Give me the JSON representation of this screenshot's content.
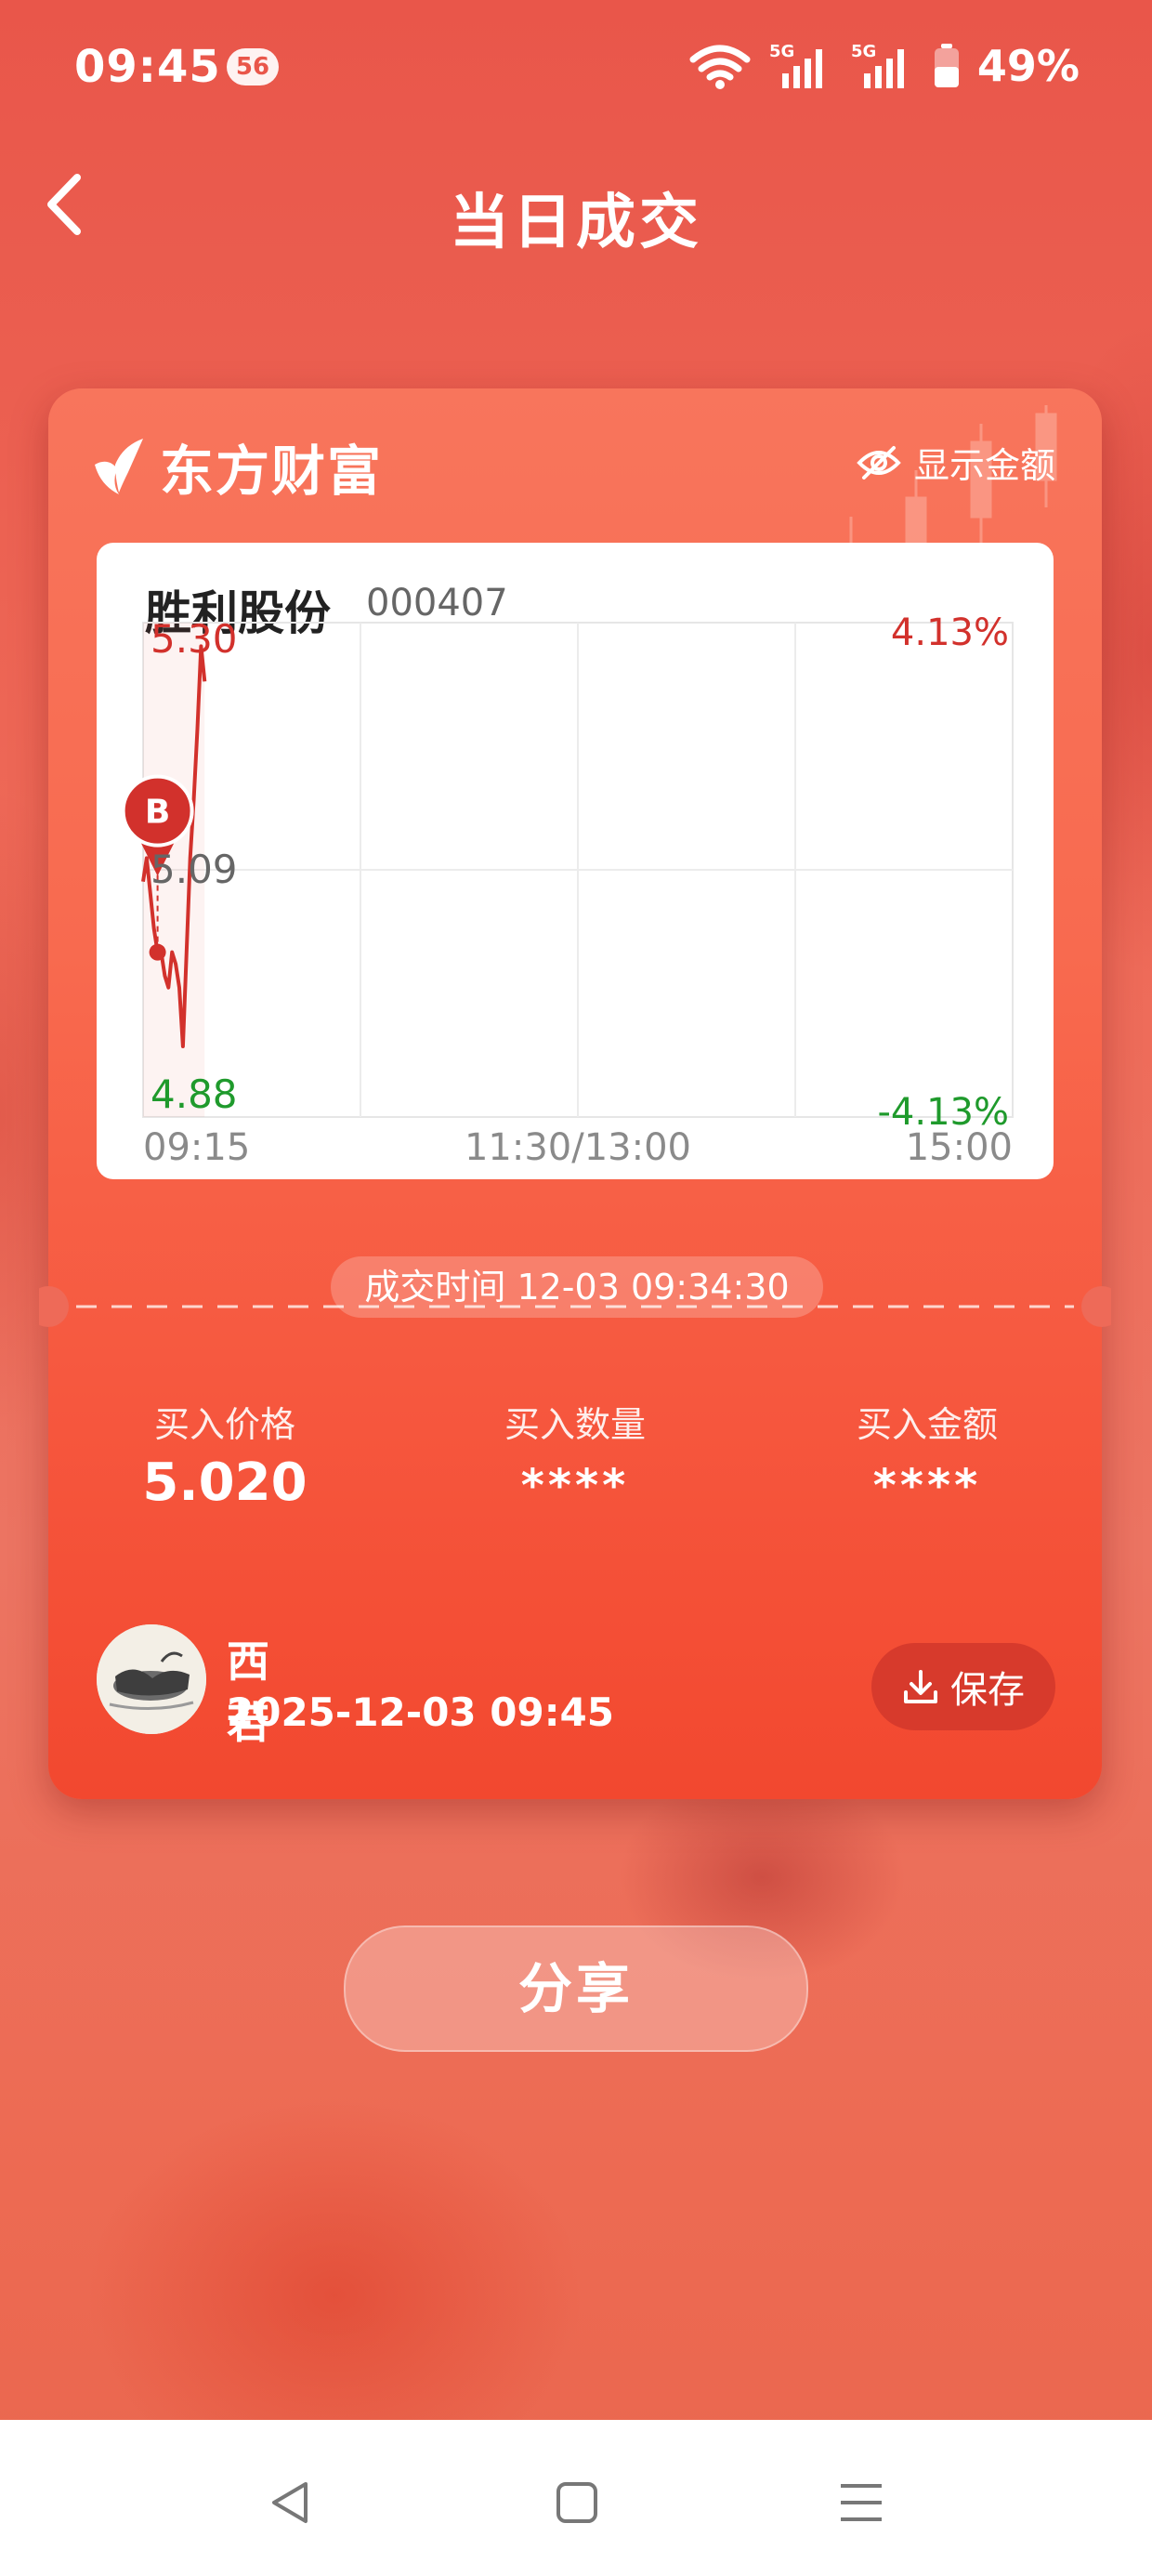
{
  "status_bar": {
    "time": "09:45",
    "badge": "56",
    "battery": "49%",
    "network_1": "5G",
    "network_2": "5G"
  },
  "nav": {
    "title": "当日成交",
    "back_icon": "chevron-left-icon"
  },
  "card": {
    "brand": "东方财富",
    "show_amount_label": "显示金额",
    "stock": {
      "name": "胜利股份",
      "code": "000407"
    },
    "trade_time": "成交时间 12-03 09:34:30",
    "metrics": [
      {
        "label": "买入价格",
        "value": "5.020"
      },
      {
        "label": "买入数量",
        "value": "****"
      },
      {
        "label": "买入金额",
        "value": "****"
      }
    ],
    "user": {
      "name": "西若",
      "datetime": "2025-12-03 09:45"
    },
    "save_label": "保存"
  },
  "share_label": "分享",
  "colors": {
    "up": "#d2312c",
    "down": "#1f9a2c",
    "accent": "#f6573e"
  },
  "chart_data": {
    "type": "line",
    "title": "",
    "xlabel": "",
    "ylabel": "",
    "ylim": [
      4.88,
      5.3
    ],
    "ytick_labels_left": [
      "5.30",
      "5.09",
      "4.88"
    ],
    "ytick_labels_right": [
      "4.13%",
      "-4.13%"
    ],
    "xtick_labels": [
      "09:15",
      "11:30/13:00",
      "15:00"
    ],
    "grid": true,
    "series": [
      {
        "values": [
          {
            "t": "09:30",
            "y": 5.08
          },
          {
            "t": "09:31",
            "y": 5.1
          },
          {
            "t": "09:32",
            "y": 5.07
          },
          {
            "t": "09:33",
            "y": 5.04
          },
          {
            "t": "09:34",
            "y": 5.02
          },
          {
            "t": "09:35",
            "y": 5.02
          },
          {
            "t": "09:36",
            "y": 5.0
          },
          {
            "t": "09:37",
            "y": 4.99
          },
          {
            "t": "09:38",
            "y": 5.02
          },
          {
            "t": "09:39",
            "y": 5.01
          },
          {
            "t": "09:40",
            "y": 4.99
          },
          {
            "t": "09:41",
            "y": 4.94
          },
          {
            "t": "09:42",
            "y": 5.02
          },
          {
            "t": "09:43",
            "y": 5.1
          },
          {
            "t": "09:44",
            "y": 5.15
          },
          {
            "t": "09:45",
            "y": 5.21
          },
          {
            "t": "09:46",
            "y": 5.28
          },
          {
            "t": "09:47",
            "y": 5.25
          }
        ]
      }
    ],
    "marker": {
      "label": "B",
      "time": "09:34",
      "price": 5.02
    }
  }
}
